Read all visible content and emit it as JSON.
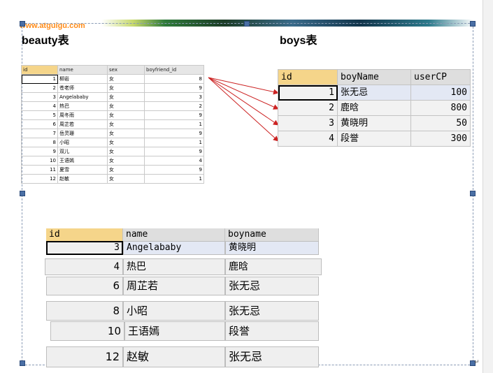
{
  "watermark": "www.atguigu.com",
  "titles": {
    "beauty": "beauty表",
    "boys": "boys表"
  },
  "beauty": {
    "columns": [
      "id",
      "name",
      "sex",
      "boyfriend_id"
    ],
    "rows": [
      [
        "1",
        "柳岩",
        "女",
        "8"
      ],
      [
        "2",
        "苍老师",
        "女",
        "9"
      ],
      [
        "3",
        "Angelababy",
        "女",
        "3"
      ],
      [
        "4",
        "热巴",
        "女",
        "2"
      ],
      [
        "5",
        "周冬雨",
        "女",
        "9"
      ],
      [
        "6",
        "周芷若",
        "女",
        "1"
      ],
      [
        "7",
        "岳灵珊",
        "女",
        "9"
      ],
      [
        "8",
        "小昭",
        "女",
        "1"
      ],
      [
        "9",
        "双儿",
        "女",
        "9"
      ],
      [
        "10",
        "王语嫣",
        "女",
        "4"
      ],
      [
        "11",
        "夏雪",
        "女",
        "9"
      ],
      [
        "12",
        "赵敏",
        "女",
        "1"
      ]
    ]
  },
  "boys": {
    "columns": [
      "id",
      "boyName",
      "userCP"
    ],
    "rows": [
      [
        "1",
        "张无忌",
        "100"
      ],
      [
        "2",
        "鹿晗",
        "800"
      ],
      [
        "3",
        "黄晓明",
        "50"
      ],
      [
        "4",
        "段誉",
        "300"
      ]
    ]
  },
  "result": {
    "columns": [
      "id",
      "name",
      "boyname"
    ],
    "rows": [
      [
        "3",
        "Angelababy",
        "黄晓明"
      ],
      [
        "4",
        "热巴",
        "鹿晗"
      ],
      [
        "6",
        "周芷若",
        "张无忌"
      ],
      [
        "8",
        "小昭",
        "张无忌"
      ],
      [
        "10",
        "王语嫣",
        "段誉"
      ],
      [
        "12",
        "赵敏",
        "张无忌"
      ]
    ]
  },
  "colors": {
    "header_highlight": "#f5d58a",
    "arrow": "#cc2222",
    "selection": "#e3e8f4"
  }
}
